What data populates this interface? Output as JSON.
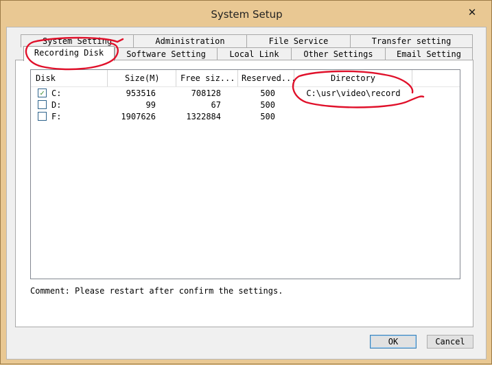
{
  "window": {
    "title": "System Setup",
    "close_glyph": "✕"
  },
  "tabs_row1": [
    "System Setting",
    "Administration",
    "File Service",
    "Transfer setting"
  ],
  "tabs_row2": [
    "Recording Disk",
    "Software Setting",
    "Local Link",
    "Other Settings",
    "Email Setting"
  ],
  "active_tab": "Recording Disk",
  "table": {
    "columns": [
      "Disk",
      "Size(M)",
      "Free siz...",
      "Reserved...",
      "Directory"
    ],
    "rows": [
      {
        "checked": true,
        "disk": "C:",
        "size": "953516",
        "free": "708128",
        "reserved": "500",
        "directory": "C:\\usr\\video\\record"
      },
      {
        "checked": false,
        "disk": "D:",
        "size": "99",
        "free": "67",
        "reserved": "500",
        "directory": ""
      },
      {
        "checked": false,
        "disk": "F:",
        "size": "1907626",
        "free": "1322884",
        "reserved": "500",
        "directory": ""
      }
    ]
  },
  "comment": "Comment: Please restart after confirm the settings.",
  "buttons": {
    "ok": "OK",
    "cancel": "Cancel"
  },
  "colors": {
    "frame": "#e9c893",
    "annotation_ink": "#e0102a",
    "check": "#3a8a2a"
  }
}
